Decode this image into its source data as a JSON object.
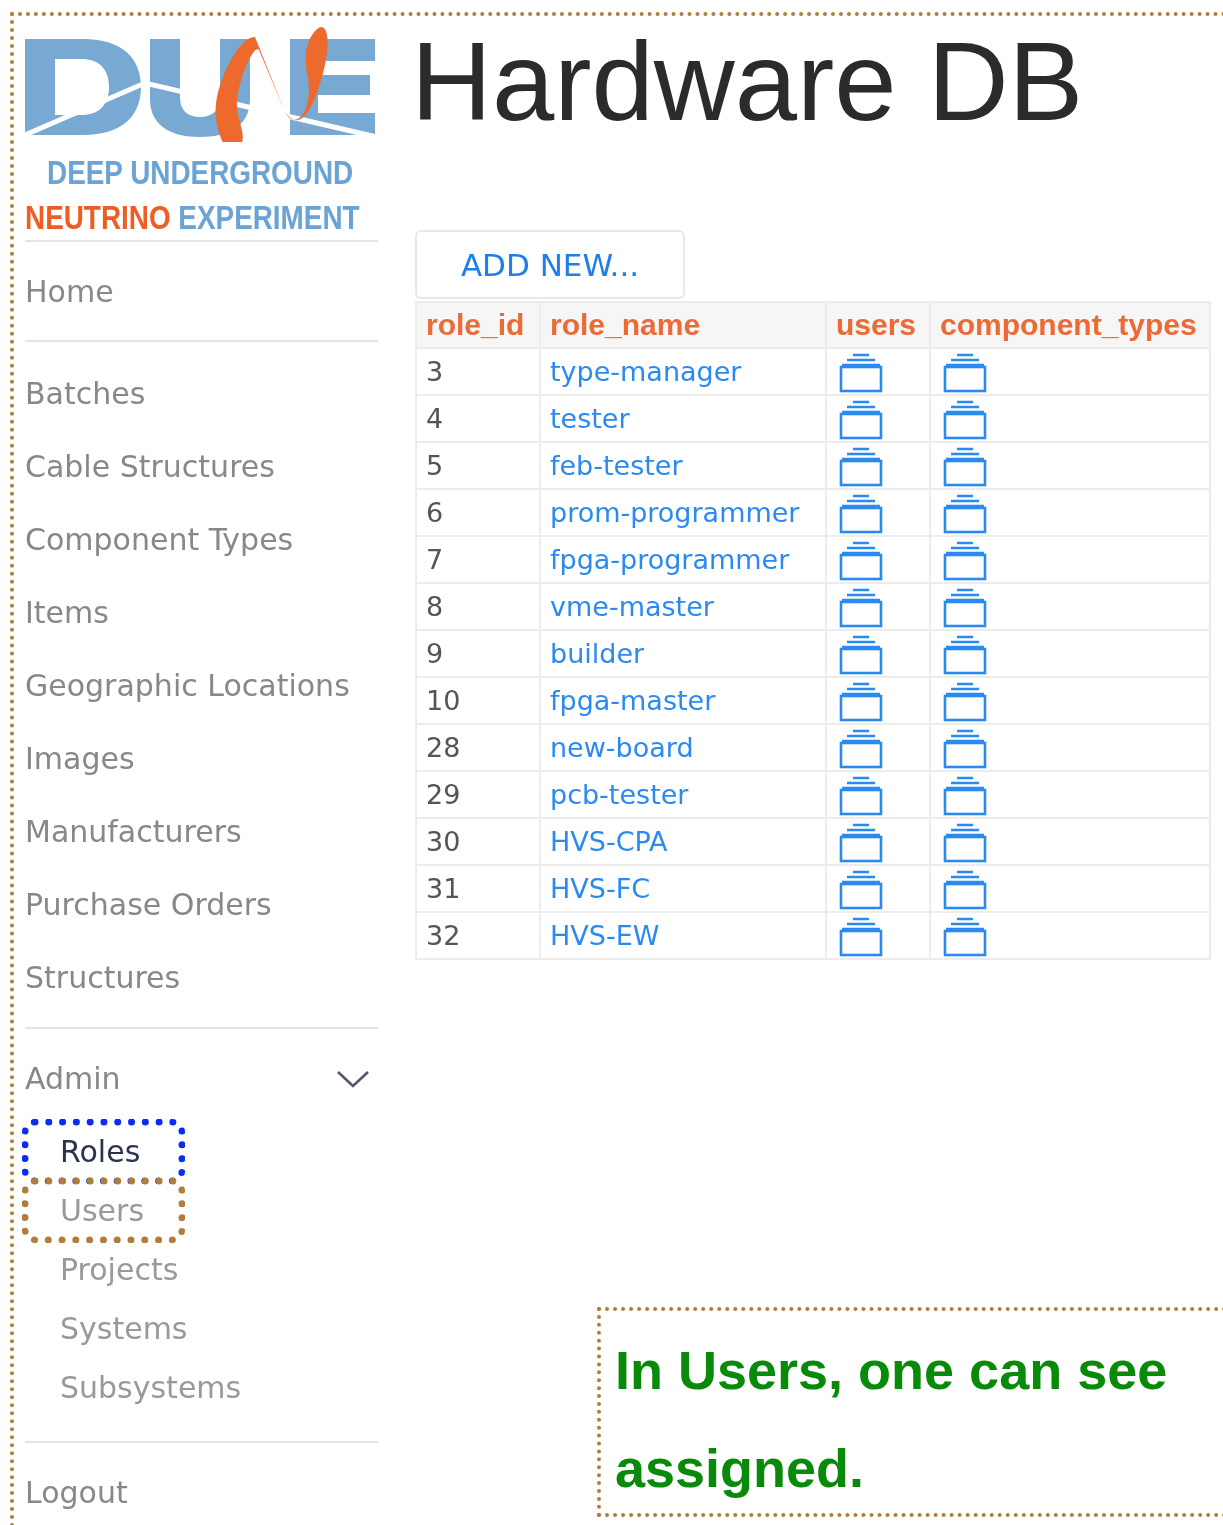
{
  "logo": {
    "line_1": "DEEP UNDERGROUND",
    "line_2_a": "NEUTRINO",
    "line_2_b": "EXPERIMENT"
  },
  "title": "Hardware DB",
  "sidebar": {
    "items": [
      {
        "label": "Home"
      }
    ],
    "sections": [
      [
        {
          "label": "Batches"
        },
        {
          "label": "Cable Structures"
        },
        {
          "label": "Component Types"
        },
        {
          "label": "Items"
        },
        {
          "label": "Geographic Locations"
        },
        {
          "label": "Images"
        },
        {
          "label": "Manufacturers"
        },
        {
          "label": "Purchase Orders"
        },
        {
          "label": "Structures"
        }
      ]
    ],
    "admin": {
      "label": "Admin",
      "expanded": true,
      "children": [
        {
          "label": "Roles",
          "selected": true,
          "color": "#0a2cf5"
        },
        {
          "label": "Users",
          "selected": false,
          "color": "#b07d3e"
        },
        {
          "label": "Projects",
          "selected": false
        },
        {
          "label": "Systems",
          "selected": false
        },
        {
          "label": "Subsystems",
          "selected": false
        }
      ]
    },
    "logout": "Logout"
  },
  "add_button": "ADD NEW...",
  "table": {
    "columns": [
      "role_id",
      "role_name",
      "users",
      "component_types"
    ],
    "rows": [
      {
        "role_id": "3",
        "role_name": "type-manager"
      },
      {
        "role_id": "4",
        "role_name": "tester"
      },
      {
        "role_id": "5",
        "role_name": "feb-tester"
      },
      {
        "role_id": "6",
        "role_name": "prom-programmer"
      },
      {
        "role_id": "7",
        "role_name": "fpga-programmer"
      },
      {
        "role_id": "8",
        "role_name": "vme-master"
      },
      {
        "role_id": "9",
        "role_name": "builder"
      },
      {
        "role_id": "10",
        "role_name": "fpga-master"
      },
      {
        "role_id": "28",
        "role_name": "new-board"
      },
      {
        "role_id": "29",
        "role_name": "pcb-tester"
      },
      {
        "role_id": "30",
        "role_name": "HVS-CPA"
      },
      {
        "role_id": "31",
        "role_name": "HVS-FC"
      },
      {
        "role_id": "32",
        "role_name": "HVS-EW"
      }
    ]
  },
  "callout": {
    "lines": [
      "In Users, one can see",
      "assigned."
    ]
  }
}
